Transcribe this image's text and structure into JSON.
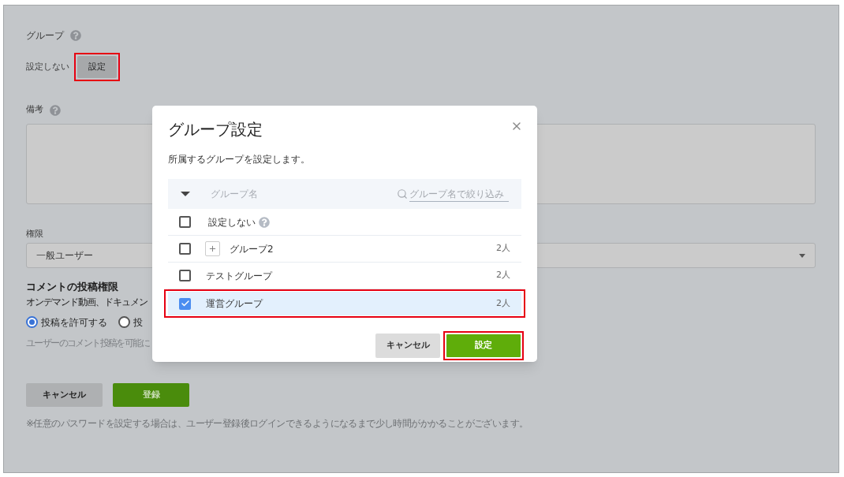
{
  "form": {
    "group": {
      "label": "グループ",
      "value": "設定しない",
      "button": {
        "label": "設定",
        "highlighted": true
      }
    },
    "notes": {
      "label": "備考"
    },
    "role": {
      "label": "権限",
      "value": "一般ユーザー"
    },
    "comment": {
      "title": "コメントの投稿権限",
      "description": "オンデマンド動画、ドキュメン",
      "options": [
        {
          "label": "投稿を許可する",
          "selected": true
        },
        {
          "label": "投",
          "selected": false
        }
      ],
      "hint": "ユーザーのコメント投稿を可能に"
    },
    "buttons": [
      {
        "label": "キャンセル",
        "kind": "secondary"
      },
      {
        "label": "登録",
        "kind": "primary"
      }
    ],
    "footnote": "※任意のパスワードを設定する場合は、ユーザー登録後ログインできるようになるまで少し時間がかかることがございます。"
  },
  "dialog": {
    "title": "グループ設定",
    "description": "所属するグループを設定します。",
    "column": "グループ名",
    "search": {
      "placeholder": "グループ名で絞り込み"
    },
    "rows": [
      {
        "kind": "none",
        "name": "設定しない",
        "checked": false,
        "highlighted": false
      },
      {
        "kind": "group",
        "name": "グループ2",
        "count": "2人",
        "checked": false,
        "highlighted": false,
        "expanded": false
      },
      {
        "kind": "group",
        "name": "テストグループ",
        "count": "2人",
        "checked": false,
        "highlighted": false
      },
      {
        "kind": "group",
        "name": "運営グループ",
        "count": "2人",
        "checked": true,
        "highlighted": true
      }
    ],
    "buttons": [
      {
        "label": "キャンセル",
        "kind": "secondary",
        "highlighted": false
      },
      {
        "label": "設定",
        "kind": "primary",
        "highlighted": true
      }
    ]
  }
}
